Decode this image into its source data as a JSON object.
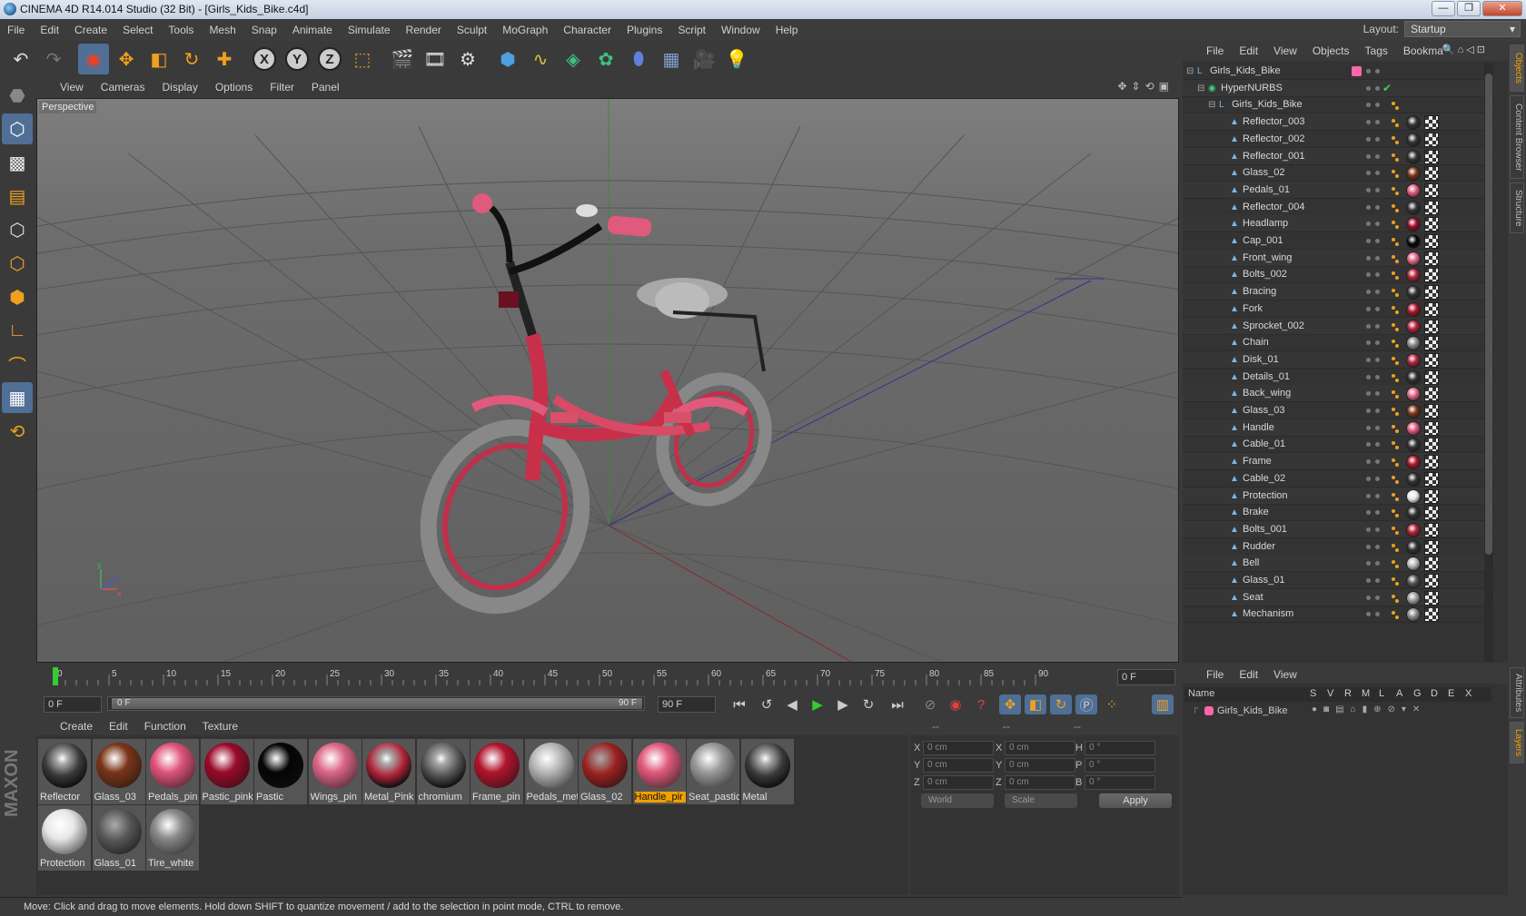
{
  "window": {
    "title": "CINEMA 4D R14.014 Studio (32 Bit) - [Girls_Kids_Bike.c4d]",
    "controls": [
      "—",
      "❐",
      "✕"
    ]
  },
  "menu": [
    "File",
    "Edit",
    "Create",
    "Select",
    "Tools",
    "Mesh",
    "Snap",
    "Animate",
    "Simulate",
    "Render",
    "Sculpt",
    "MoGraph",
    "Character",
    "Plugins",
    "Script",
    "Window",
    "Help"
  ],
  "layout": {
    "label": "Layout:",
    "value": "Startup"
  },
  "viewport": {
    "menu": [
      "View",
      "Cameras",
      "Display",
      "Options",
      "Filter",
      "Panel"
    ],
    "label": "Perspective",
    "axis_labels": {
      "x": "x",
      "y": "y",
      "z": "z"
    }
  },
  "timeline": {
    "ticks": [
      "0",
      "5",
      "10",
      "15",
      "20",
      "25",
      "30",
      "35",
      "40",
      "45",
      "50",
      "55",
      "60",
      "65",
      "70",
      "75",
      "80",
      "85",
      "90"
    ],
    "current_frame": "0 F",
    "start_frame": "0 F",
    "slider_start": "0 F",
    "slider_end": "90 F",
    "end_frame": "90 F"
  },
  "materials": {
    "menu": [
      "Create",
      "Edit",
      "Function",
      "Texture"
    ],
    "items": [
      {
        "name": "Reflector",
        "color": "#3a3a3a",
        "style": "chrome"
      },
      {
        "name": "Glass_03",
        "color": "#7a3518",
        "style": "solid"
      },
      {
        "name": "Pedals_pin",
        "color": "#e0557a",
        "style": "solid"
      },
      {
        "name": "Pastic_pink",
        "color": "#9a0a2a",
        "style": "solid"
      },
      {
        "name": "Pastic",
        "color": "#050505",
        "style": "solid"
      },
      {
        "name": "Wings_pin",
        "color": "#dd6688",
        "style": "solid"
      },
      {
        "name": "Metal_Pink",
        "color": "#b02238",
        "style": "chrome"
      },
      {
        "name": "chromium",
        "color": "#555555",
        "style": "chrome"
      },
      {
        "name": "Frame_pin",
        "color": "#b0142c",
        "style": "solid"
      },
      {
        "name": "Pedals_met",
        "color": "#b8b8b8",
        "style": "solid"
      },
      {
        "name": "Glass_02",
        "color": "#9a2020",
        "style": "glass"
      },
      {
        "name": "Handle_pir",
        "color": "#e05a7c",
        "style": "solid",
        "selected": true
      },
      {
        "name": "Seat_pastic",
        "color": "#9a9a9a",
        "style": "solid"
      },
      {
        "name": "Metal",
        "color": "#3a3a3a",
        "style": "chrome"
      },
      {
        "name": "Protection",
        "color": "#e8e8e8",
        "style": "solid"
      },
      {
        "name": "Glass_01",
        "color": "#555555",
        "style": "glass"
      },
      {
        "name": "Tire_white",
        "color": "#888888",
        "style": "solid"
      }
    ]
  },
  "coords": {
    "header": [
      "--",
      "--",
      "--"
    ],
    "rows": [
      {
        "a": "X",
        "av": "0 cm",
        "b": "X",
        "bv": "0 cm",
        "c": "H",
        "cv": "0 °"
      },
      {
        "a": "Y",
        "av": "0 cm",
        "b": "Y",
        "bv": "0 cm",
        "c": "P",
        "cv": "0 °"
      },
      {
        "a": "Z",
        "av": "0 cm",
        "b": "Z",
        "bv": "0 cm",
        "c": "B",
        "cv": "0 °"
      }
    ],
    "world": "World",
    "scale": "Scale",
    "apply": "Apply"
  },
  "objects": {
    "menu": [
      "File",
      "Edit",
      "View",
      "Objects",
      "Tags",
      "Bookma"
    ],
    "items": [
      {
        "name": "Girls_Kids_Bike",
        "level": 0,
        "kind": "null",
        "tag_color": "#ff66aa"
      },
      {
        "name": "HyperNURBS",
        "level": 1,
        "kind": "nurbs",
        "tag_color": ""
      },
      {
        "name": "Girls_Kids_Bike",
        "level": 2,
        "kind": "null",
        "tag_color": ""
      },
      {
        "name": "Reflector_003",
        "level": 3,
        "kind": "poly",
        "tag_color": "#333333"
      },
      {
        "name": "Reflector_002",
        "level": 3,
        "kind": "poly",
        "tag_color": "#333333"
      },
      {
        "name": "Reflector_001",
        "level": 3,
        "kind": "poly",
        "tag_color": "#333333"
      },
      {
        "name": "Glass_02",
        "level": 3,
        "kind": "poly",
        "tag_color": "#7a3518"
      },
      {
        "name": "Pedals_01",
        "level": 3,
        "kind": "poly",
        "tag_color": "#e05a7c"
      },
      {
        "name": "Reflector_004",
        "level": 3,
        "kind": "poly",
        "tag_color": "#333333"
      },
      {
        "name": "Headlamp",
        "level": 3,
        "kind": "poly",
        "tag_color": "#9a0a2a"
      },
      {
        "name": "Cap_001",
        "level": 3,
        "kind": "poly",
        "tag_color": "#050505"
      },
      {
        "name": "Front_wing",
        "level": 3,
        "kind": "poly",
        "tag_color": "#dd6688"
      },
      {
        "name": "Bolts_002",
        "level": 3,
        "kind": "poly",
        "tag_color": "#b02238"
      },
      {
        "name": "Bracing",
        "level": 3,
        "kind": "poly",
        "tag_color": "#333333"
      },
      {
        "name": "Fork",
        "level": 3,
        "kind": "poly",
        "tag_color": "#b0142c"
      },
      {
        "name": "Sprocket_002",
        "level": 3,
        "kind": "poly",
        "tag_color": "#b02238"
      },
      {
        "name": "Chain",
        "level": 3,
        "kind": "poly",
        "tag_color": "#888888"
      },
      {
        "name": "Disk_01",
        "level": 3,
        "kind": "poly",
        "tag_color": "#b02238"
      },
      {
        "name": "Details_01",
        "level": 3,
        "kind": "poly",
        "tag_color": "#333333"
      },
      {
        "name": "Back_wing",
        "level": 3,
        "kind": "poly",
        "tag_color": "#dd6688"
      },
      {
        "name": "Glass_03",
        "level": 3,
        "kind": "poly",
        "tag_color": "#7a3518"
      },
      {
        "name": "Handle",
        "level": 3,
        "kind": "poly",
        "tag_color": "#e05a7c"
      },
      {
        "name": "Cable_01",
        "level": 3,
        "kind": "poly",
        "tag_color": "#333333"
      },
      {
        "name": "Frame",
        "level": 3,
        "kind": "poly",
        "tag_color": "#b0142c"
      },
      {
        "name": "Cable_02",
        "level": 3,
        "kind": "poly",
        "tag_color": "#333333"
      },
      {
        "name": "Protection",
        "level": 3,
        "kind": "poly",
        "tag_color": "#e8e8e8"
      },
      {
        "name": "Brake",
        "level": 3,
        "kind": "poly",
        "tag_color": "#333333"
      },
      {
        "name": "Bolts_001",
        "level": 3,
        "kind": "poly",
        "tag_color": "#b02238"
      },
      {
        "name": "Rudder",
        "level": 3,
        "kind": "poly",
        "tag_color": "#333333"
      },
      {
        "name": "Bell",
        "level": 3,
        "kind": "poly",
        "tag_color": "#b8b8b8"
      },
      {
        "name": "Glass_01",
        "level": 3,
        "kind": "poly",
        "tag_color": "#555555"
      },
      {
        "name": "Seat",
        "level": 3,
        "kind": "poly",
        "tag_color": "#9a9a9a"
      },
      {
        "name": "Mechanism",
        "level": 3,
        "kind": "poly",
        "tag_color": "#888888"
      }
    ]
  },
  "side_tabs": {
    "top": [
      "Objects",
      "Content Browser",
      "Structure"
    ],
    "bottom": [
      "Attributes",
      "Layers"
    ]
  },
  "attributes": {
    "menu": [
      "File",
      "Edit",
      "View"
    ],
    "columns": [
      "Name",
      "S",
      "V",
      "R",
      "M",
      "L",
      "A",
      "G",
      "D",
      "E",
      "X"
    ],
    "row_name": "Girls_Kids_Bike",
    "row_color": "#ff66aa"
  },
  "status": "Move: Click and drag to move elements. Hold down SHIFT to quantize movement / add to the selection in point mode, CTRL to remove."
}
